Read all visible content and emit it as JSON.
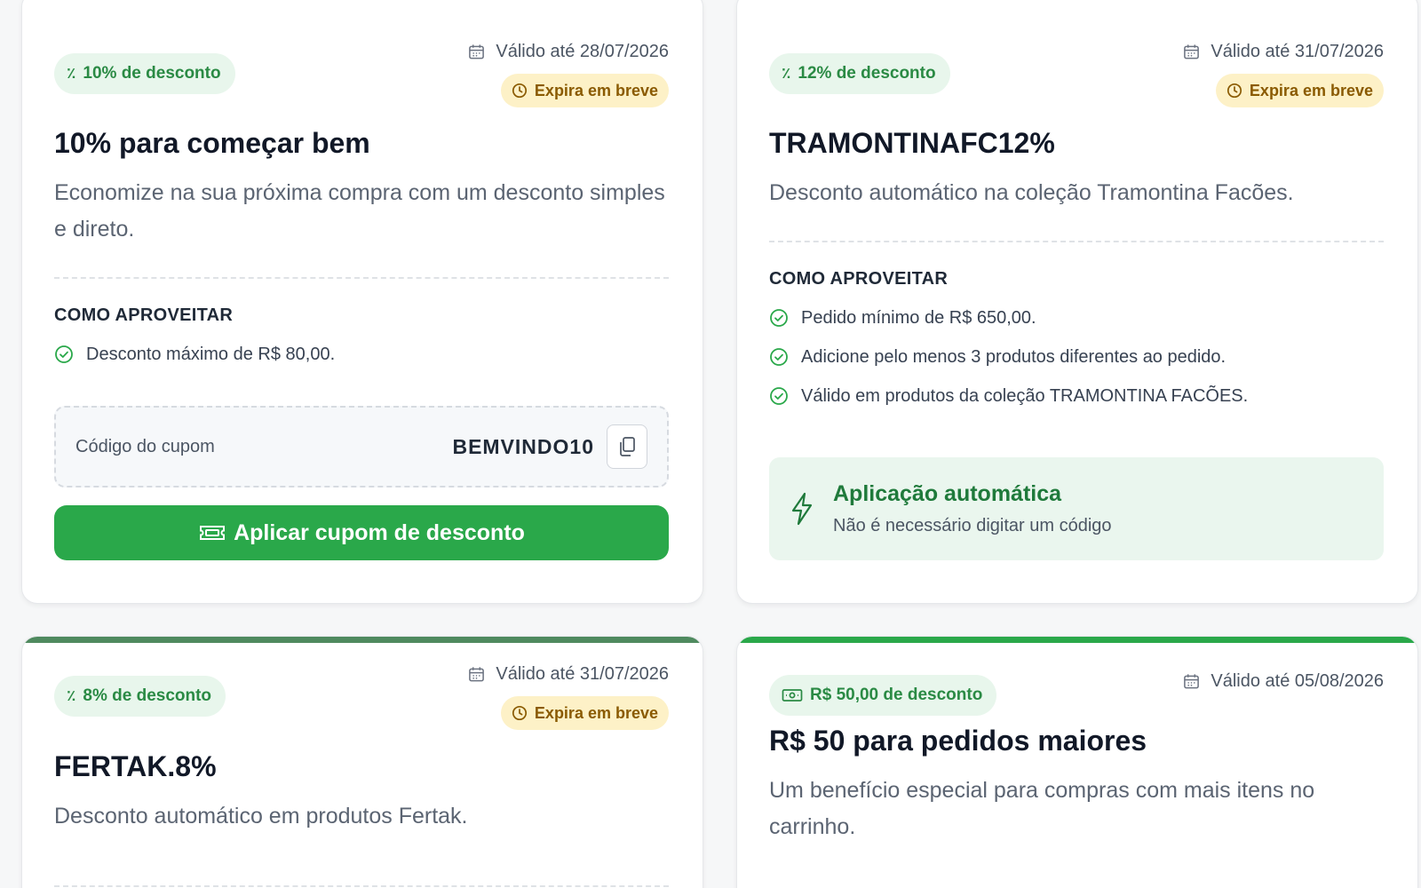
{
  "theme": {
    "green": "#2aa84a",
    "green_dark": "#1e7a3a",
    "green_badge_bg": "#e8f6ec",
    "green_muted": "#4f8a5f",
    "amber_bg": "#fdf1c7",
    "amber_text": "#8a5a00",
    "auto_bg": "#eaf6ee",
    "auto_title": "#1f7a3b"
  },
  "coupons": [
    {
      "badge": {
        "icon": "percent-icon",
        "label": "10% de desconto"
      },
      "valid_until": "Válido até 28/07/2026",
      "expire_label": "Expira em breve",
      "title": "10% para começar bem",
      "description": "Economize na sua próxima compra com um desconto simples e direto.",
      "howto_title": "COMO APROVEITAR",
      "rules": [
        "Desconto máximo de R$ 80,00."
      ],
      "code_label": "Código do cupom",
      "code": "BEMVINDO10",
      "apply_label": "Aplicar cupom de desconto"
    },
    {
      "badge": {
        "icon": "percent-icon",
        "label": "12% de desconto"
      },
      "valid_until": "Válido até 31/07/2026",
      "expire_label": "Expira em breve",
      "title": "TRAMONTINAFC12%",
      "description": "Desconto automático na coleção Tramontina Facões.",
      "howto_title": "COMO APROVEITAR",
      "rules": [
        "Pedido mínimo de R$ 650,00.",
        "Adicione pelo menos 3 produtos diferentes ao pedido.",
        "Válido em produtos da coleção TRAMONTINA FACÕES."
      ],
      "auto_title": "Aplicação automática",
      "auto_subtitle": "Não é necessário digitar um código"
    },
    {
      "badge": {
        "icon": "percent-icon",
        "label": "8% de desconto"
      },
      "valid_until": "Válido até 31/07/2026",
      "expire_label": "Expira em breve",
      "title": "FERTAK.8%",
      "description": "Desconto automático em produtos Fertak."
    },
    {
      "badge": {
        "icon": "cash-icon",
        "label": "R$ 50,00 de desconto"
      },
      "valid_until": "Válido até 05/08/2026",
      "title": "R$ 50 para pedidos maiores",
      "description": "Um benefício especial para compras com mais itens no carrinho."
    }
  ]
}
